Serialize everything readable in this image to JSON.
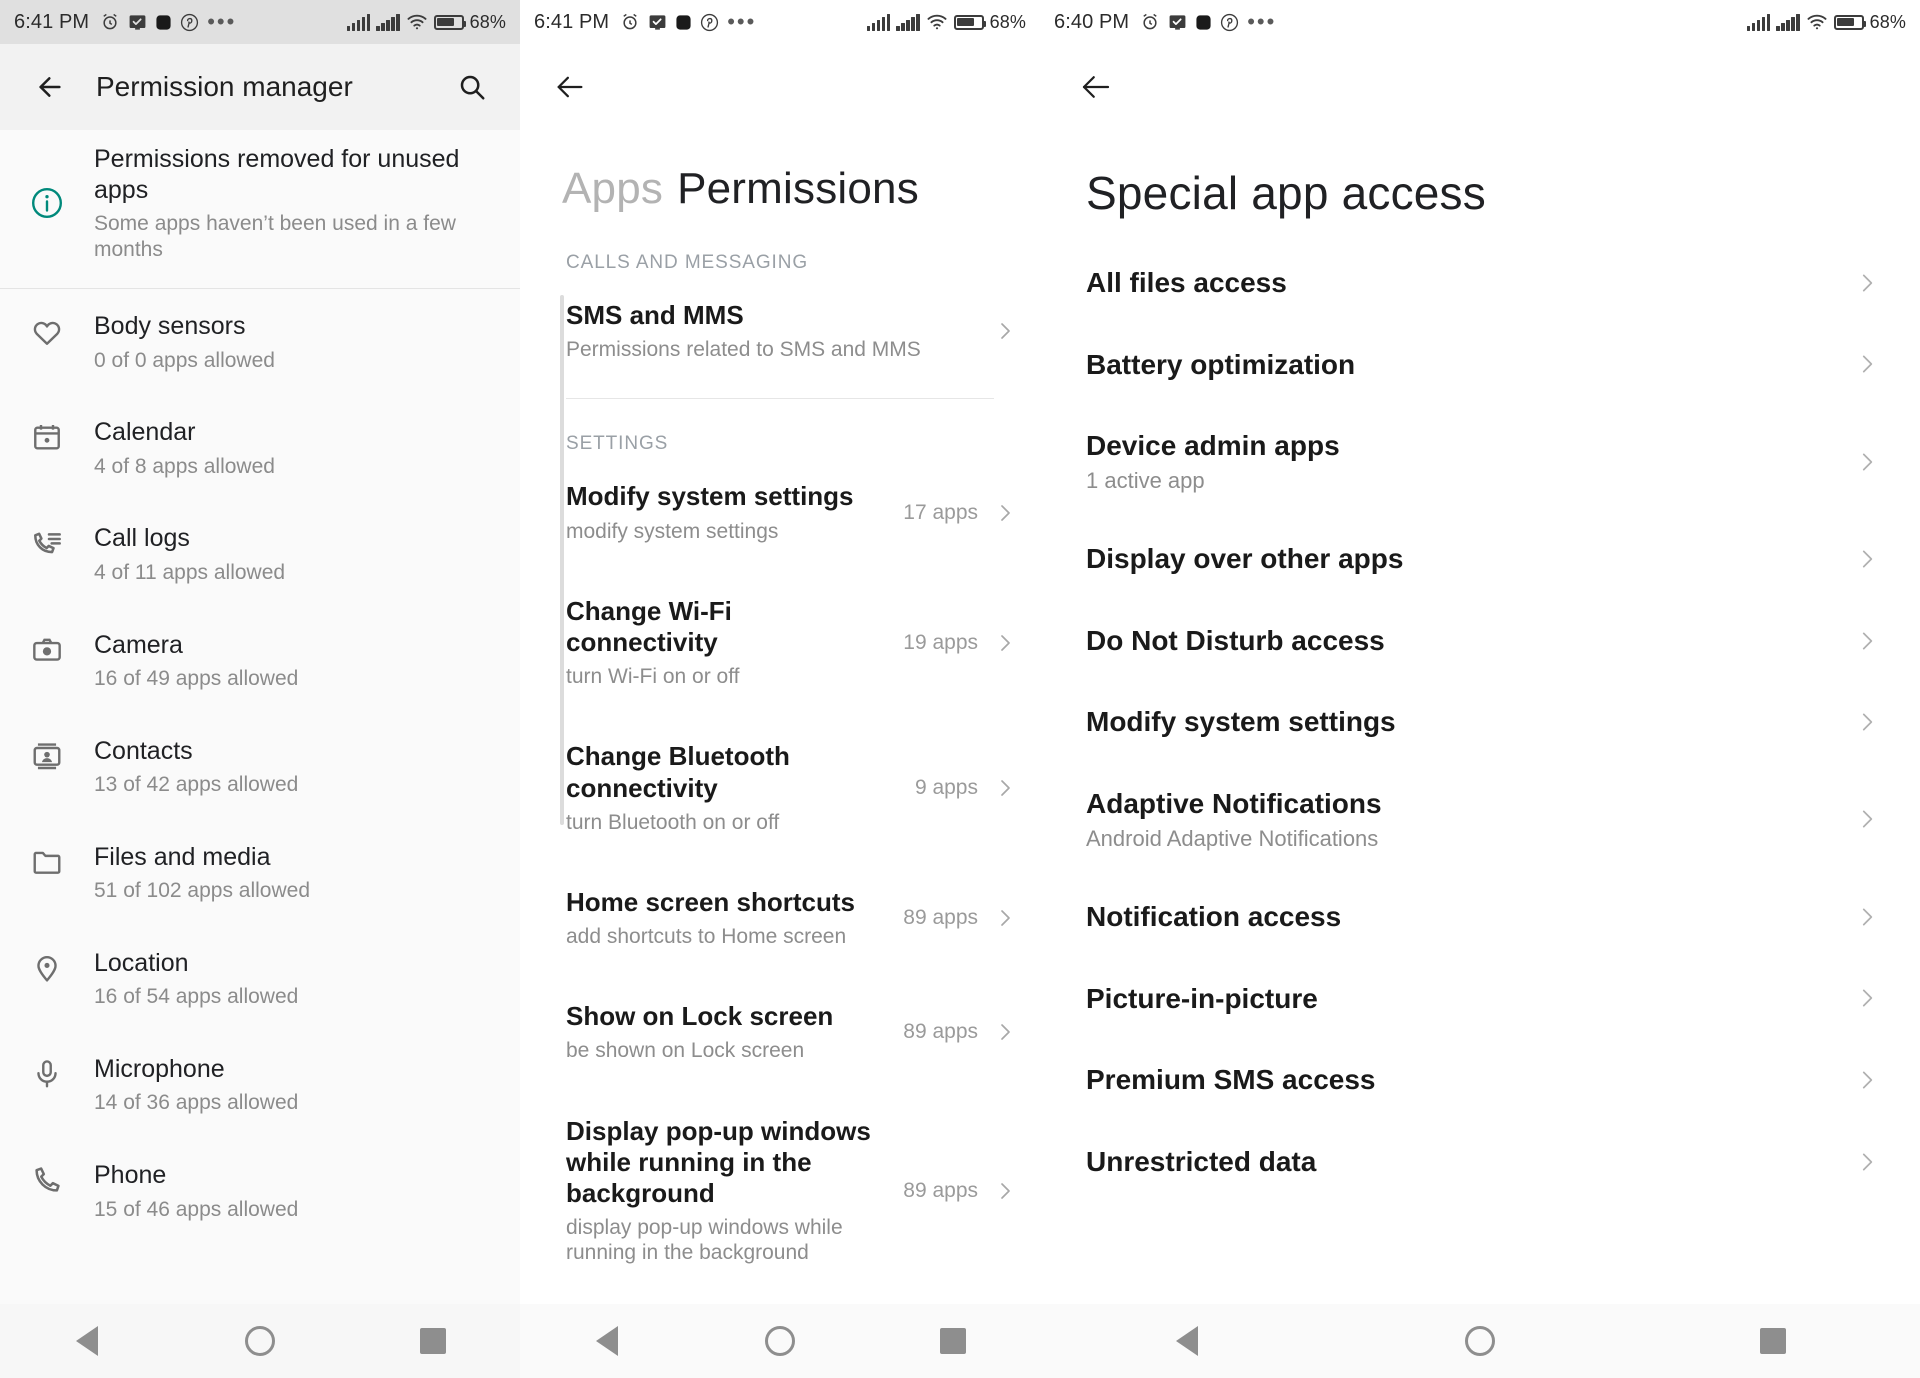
{
  "panels": [
    {
      "status": {
        "time": "6:41 PM",
        "icons": [
          "alarm-icon",
          "screenshot-icon",
          "square-icon",
          "pinterest-icon",
          "overflow-dots-icon"
        ],
        "signal_1": "signal-bars-icon",
        "signal_2": "signal-bars-icon",
        "wifi": "wifi-icon",
        "battery": "battery-icon",
        "battery_level": "68%"
      },
      "appbar": {
        "back": "back-arrow-icon",
        "title": "Permission manager",
        "search": "search-icon"
      },
      "items": [
        {
          "icon": "info-circle-icon",
          "title": "Permissions removed for unused apps",
          "sub": "Some apps haven’t been used in a few months",
          "kind": "info"
        },
        {
          "icon": "heart-icon",
          "title": "Body sensors",
          "sub": "0 of 0 apps allowed"
        },
        {
          "icon": "calendar-icon",
          "title": "Calendar",
          "sub": "4 of 8 apps allowed"
        },
        {
          "icon": "call-logs-icon",
          "title": "Call logs",
          "sub": "4 of 11 apps allowed"
        },
        {
          "icon": "camera-icon",
          "title": "Camera",
          "sub": "16 of 49 apps allowed"
        },
        {
          "icon": "contacts-icon",
          "title": "Contacts",
          "sub": "13 of 42 apps allowed"
        },
        {
          "icon": "folder-icon",
          "title": "Files and media",
          "sub": "51 of 102 apps allowed"
        },
        {
          "icon": "location-pin-icon",
          "title": "Location",
          "sub": "16 of 54 apps allowed"
        },
        {
          "icon": "microphone-icon",
          "title": "Microphone",
          "sub": "14 of 36 apps allowed"
        },
        {
          "icon": "phone-icon",
          "title": "Phone",
          "sub": "15 of 46 apps allowed"
        }
      ],
      "nav": [
        "back-triangle-icon",
        "home-circle-icon",
        "recents-square-icon"
      ]
    },
    {
      "status": {
        "time": "6:41 PM",
        "battery_level": "68%"
      },
      "appbar": {
        "back": "back-arrow-icon"
      },
      "header_muted": "Apps",
      "header_main": "Permissions",
      "sections": [
        {
          "label": "CALLS AND MESSAGING",
          "items": [
            {
              "title": "SMS and MMS",
              "sub": "Permissions related to SMS and MMS",
              "count": ""
            }
          ]
        },
        {
          "label": "SETTINGS",
          "items": [
            {
              "title": "Modify system settings",
              "sub": "modify system settings",
              "count": "17 apps"
            },
            {
              "title": "Change Wi-Fi connectivity",
              "sub": "turn Wi-Fi on or off",
              "count": "19 apps"
            },
            {
              "title": "Change Bluetooth connectivity",
              "sub": "turn Bluetooth on or off",
              "count": "9 apps"
            },
            {
              "title": "Home screen shortcuts",
              "sub": "add shortcuts to Home screen",
              "count": "89 apps"
            },
            {
              "title": "Show on Lock screen",
              "sub": "be shown on Lock screen",
              "count": "89 apps"
            },
            {
              "title": "Display pop-up windows while running in the background",
              "sub": "display pop-up windows while running in the background",
              "count": "89 apps"
            }
          ]
        }
      ],
      "nav": [
        "back-triangle-icon",
        "home-circle-icon",
        "recents-square-icon"
      ]
    },
    {
      "status": {
        "time": "6:40 PM",
        "battery_level": "68%"
      },
      "appbar": {
        "back": "back-arrow-icon"
      },
      "header_main": "Special app access",
      "items": [
        {
          "title": "All files access",
          "sub": ""
        },
        {
          "title": "Battery optimization",
          "sub": ""
        },
        {
          "title": "Device admin apps",
          "sub": "1 active app"
        },
        {
          "title": "Display over other apps",
          "sub": ""
        },
        {
          "title": "Do Not Disturb access",
          "sub": ""
        },
        {
          "title": "Modify system settings",
          "sub": ""
        },
        {
          "title": "Adaptive Notifications",
          "sub": "Android Adaptive Notifications"
        },
        {
          "title": "Notification access",
          "sub": ""
        },
        {
          "title": "Picture-in-picture",
          "sub": ""
        },
        {
          "title": "Premium SMS access",
          "sub": ""
        },
        {
          "title": "Unrestricted data",
          "sub": ""
        }
      ],
      "nav": [
        "back-triangle-icon",
        "home-circle-icon",
        "recents-square-icon"
      ]
    }
  ],
  "colors": {
    "accent_teal": "#00897b",
    "text_primary": "#1f1f1f",
    "text_secondary": "#8b8b8b",
    "section_label": "#9aa0a6",
    "divider": "#e4e4e4"
  }
}
